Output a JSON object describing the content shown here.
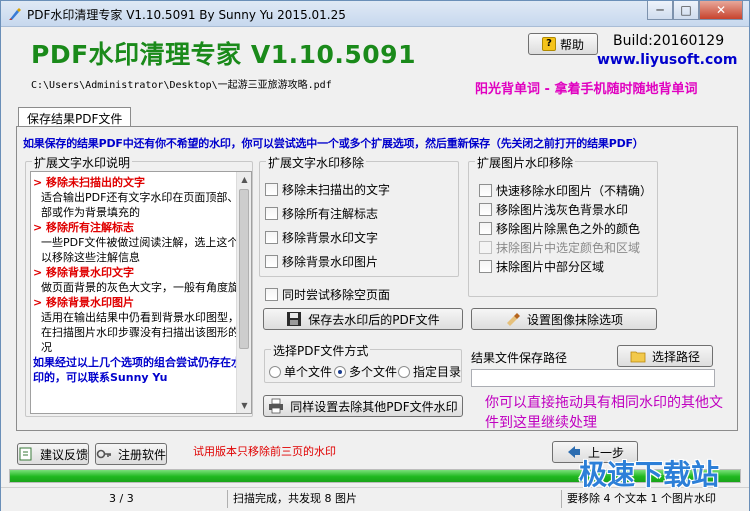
{
  "window": {
    "title": "PDF水印清理专家 V1.10.5091 By Sunny Yu 2015.01.25",
    "minimize": "─",
    "maximize": "□",
    "close": "✕"
  },
  "header": {
    "brand": "PDF水印清理专家 V1.10.5091",
    "file_path": "C:\\Users\\Administrator\\Desktop\\一起游三亚旅游攻略.pdf",
    "help_label": "帮助",
    "help_icon": "question-icon",
    "build": "Build:20160129",
    "website": "www.liyusoft.com",
    "slogan": "阳光背单词 - 拿着手机随时随地背单词"
  },
  "tab": {
    "label": "保存结果PDF文件"
  },
  "notice": "如果保存的结果PDF中还有你不希望的水印，你可以尝试选中一个或多个扩展选项，然后重新保存（先关闭之前打开的结果PDF）",
  "desc_group": {
    "title": "扩展文字水印说明",
    "lines": [
      {
        "t": "h",
        "text": "> 移除未扫描出的文字"
      },
      {
        "t": "p",
        "text": "适合输出PDF还有文字水印在页面顶部、底部或作为背景填充的"
      },
      {
        "t": "h",
        "text": "> 移除所有注解标志"
      },
      {
        "t": "p",
        "text": "一些PDF文件被做过阅读注解，选上这个可以移除这些注解信息"
      },
      {
        "t": "h",
        "text": "> 移除背景水印文字"
      },
      {
        "t": "p",
        "text": "做页面背景的灰色大文字，一般有角度旋转"
      },
      {
        "t": "h",
        "text": "> 移除背景水印图片"
      },
      {
        "t": "p",
        "text": "适用在输出结果中仍看到背景水印图型，但在扫描图片水印步骤没有扫描出该图形的情况"
      },
      {
        "t": "b",
        "text": "如果经过以上几个选项的组合尝试仍存在水印的，可以联系Sunny Yu"
      }
    ]
  },
  "text_group": {
    "title": "扩展文字水印移除",
    "options": [
      "移除未扫描出的文字",
      "移除所有注解标志",
      "移除背景水印文字",
      "移除背景水印图片"
    ]
  },
  "image_group": {
    "title": "扩展图片水印移除",
    "options": [
      "快速移除水印图片（不精确）",
      "移除图片浅灰色背景水印",
      "移除图片除黑色之外的颜色",
      "抹除图片中选定颜色和区域",
      "抹除图片中部分区域"
    ]
  },
  "blank_page_option": "同时尝试移除空页面",
  "save_button": "保存去水印后的PDF文件",
  "erase_settings_button": "设置图像抹除选项",
  "mode_group": {
    "title": "选择PDF文件方式",
    "options": [
      {
        "label": "单个文件",
        "selected": false
      },
      {
        "label": "多个文件",
        "selected": true
      },
      {
        "label": "指定目录",
        "selected": false
      }
    ]
  },
  "output_path": {
    "label": "结果文件保存路径",
    "button": "选择路径",
    "value": ""
  },
  "apply_same_button": "同样设置去除其他PDF文件水印",
  "drop_hint": "你可以直接拖动具有相同水印的其他文件到这里继续处理",
  "feedback_button": "建议反馈",
  "register_button": "注册软件",
  "trial_notice": "试用版本只移除前三页的水印",
  "prev_button": "上一步",
  "progress": {
    "percent": 100,
    "color": "#1fb81f"
  },
  "status": {
    "pages": "3 / 3",
    "scan": "扫描完成，共发现 8 图片",
    "remove": "要移除 4 个文本 1 个图片水印"
  },
  "watermark_text": "极速下载站",
  "colors": {
    "brand": "#1a8a1a",
    "notice": "#0000cc",
    "slogan": "#e000c0",
    "red": "#e00000"
  }
}
